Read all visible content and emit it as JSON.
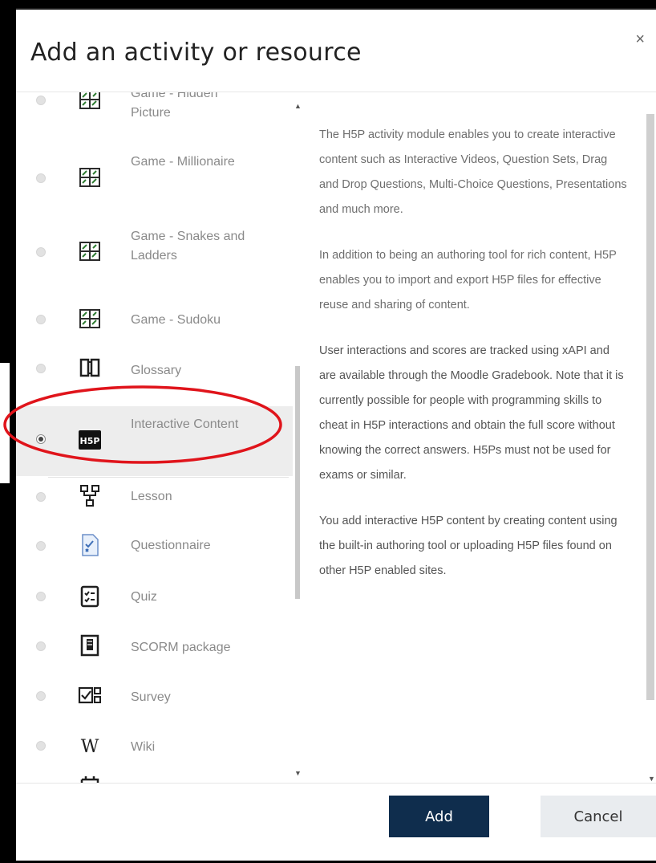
{
  "dialog": {
    "title": "Add an activity or resource",
    "close_label": "×"
  },
  "activities": [
    {
      "label": "Game - Hidden Picture",
      "icon": "game-grid-icon",
      "selected": false
    },
    {
      "label": "Game - Millionaire",
      "icon": "game-grid-icon",
      "selected": false
    },
    {
      "label": "Game - Snakes and Ladders",
      "icon": "game-grid-icon",
      "selected": false
    },
    {
      "label": "Game - Sudoku",
      "icon": "game-grid-icon",
      "selected": false
    },
    {
      "label": "Glossary",
      "icon": "book-icon",
      "selected": false
    },
    {
      "label": "Interactive Content",
      "icon": "h5p-icon",
      "selected": true
    },
    {
      "label": "Lesson",
      "icon": "lesson-flow-icon",
      "selected": false
    },
    {
      "label": "Questionnaire",
      "icon": "questionnaire-icon",
      "selected": false
    },
    {
      "label": "Quiz",
      "icon": "quiz-checklist-icon",
      "selected": false
    },
    {
      "label": "SCORM package",
      "icon": "scorm-package-icon",
      "selected": false
    },
    {
      "label": "Survey",
      "icon": "survey-icon",
      "selected": false
    },
    {
      "label": "Wiki",
      "icon": "wiki-icon",
      "selected": false
    }
  ],
  "description": {
    "p1": "The H5P activity module enables you to create interactive content such as Interactive Videos, Question Sets, Drag and Drop Questions, Multi-Choice Questions, Presentations and much more.",
    "p2": "In addition to being an authoring tool for rich content, H5P enables you to import and export H5P files for effective reuse and sharing of content.",
    "p3": "User interactions and scores are tracked using xAPI and are available through the Moodle Gradebook. Note that it is currently possible for people with programming skills to cheat in H5P interactions and obtain the full score without knowing the correct answers. H5Ps must not be used for exams or similar.",
    "p4": "You add interactive H5P content by creating content using the built-in authoring tool or uploading H5P files found on other H5P enabled sites."
  },
  "buttons": {
    "add": "Add",
    "cancel": "Cancel"
  },
  "colors": {
    "primary_button": "#0f2d4d",
    "annotation_circle": "#e0141b",
    "selected_row": "#ededed"
  }
}
